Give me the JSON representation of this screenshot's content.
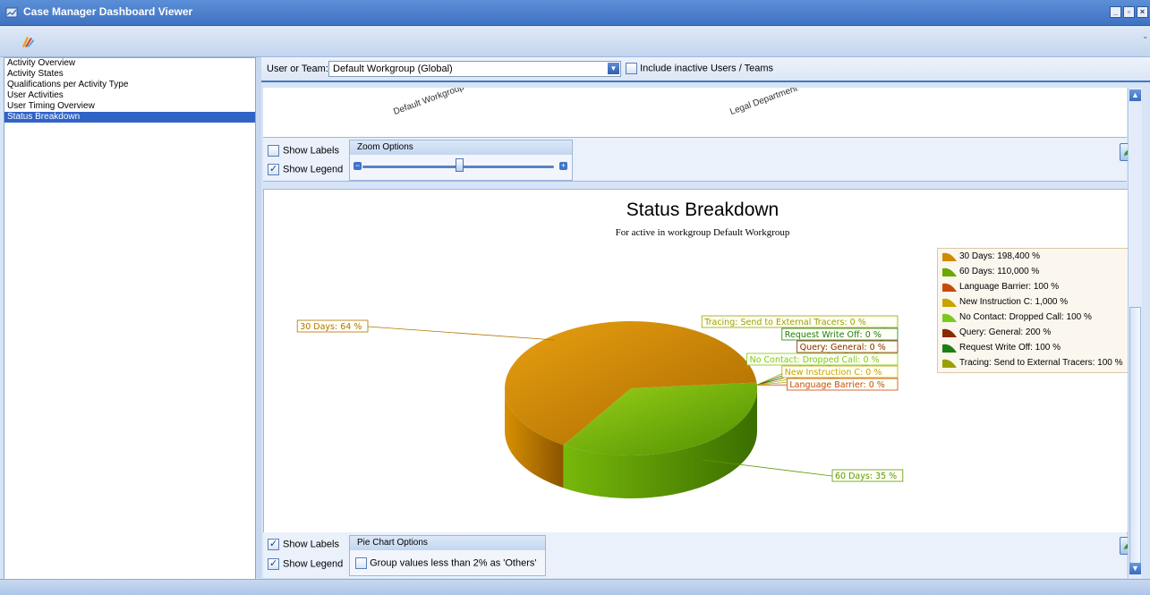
{
  "window": {
    "title": "Case Manager Dashboard Viewer",
    "buttons": [
      "_",
      "▫",
      "×"
    ]
  },
  "nav": {
    "items": [
      {
        "label": "Activity Overview",
        "selected": false
      },
      {
        "label": "Activity States",
        "selected": false
      },
      {
        "label": "Qualifications per Activity Type",
        "selected": false
      },
      {
        "label": "User Activities",
        "selected": false
      },
      {
        "label": "User Timing Overview",
        "selected": false
      },
      {
        "label": "Status Breakdown",
        "selected": true
      }
    ]
  },
  "filter": {
    "label": "User or Team:",
    "value": "Default Workgroup (Global)",
    "include_inactive_label": "Include inactive Users / Teams",
    "include_inactive": false
  },
  "top_chart": {
    "x_labels": [
      "Default Workgroup",
      "Legal Department"
    ]
  },
  "top_options": {
    "show_labels_label": "Show Labels",
    "show_labels": false,
    "show_legend_label": "Show Legend",
    "show_legend": true,
    "zoom_header": "Zoom Options",
    "zoom_minus": "−",
    "zoom_plus": "+"
  },
  "bottom_options": {
    "show_labels_label": "Show Labels",
    "show_labels": true,
    "show_legend_label": "Show Legend",
    "show_legend": true,
    "pie_header": "Pie Chart Options",
    "group_label": "Group values less than 2% as 'Others'",
    "group_checked": false
  },
  "chart_data": {
    "type": "pie",
    "title": "Status Breakdown",
    "subtitle": "For active in workgroup Default Workgroup",
    "slices": [
      {
        "name": "30 Days",
        "percent": 64,
        "label": "30 Days: 64 %",
        "color": "#d08a00"
      },
      {
        "name": "60 Days",
        "percent": 35,
        "label": "60 Days: 35 %",
        "color": "#6aa800"
      },
      {
        "name": "Language Barrier",
        "percent": 0,
        "label": "Language Barrier: 0 %",
        "color": "#c84a0a"
      },
      {
        "name": "New Instruction C",
        "percent": 0,
        "label": "New Instruction C: 0 %",
        "color": "#c8a400"
      },
      {
        "name": "No Contact: Dropped Call",
        "percent": 0,
        "label": "No Contact: Dropped Call: 0 %",
        "color": "#7cc81e"
      },
      {
        "name": "Query: General",
        "percent": 0,
        "label": "Query: General: 0 %",
        "color": "#8a2a00"
      },
      {
        "name": "Request Write Off",
        "percent": 0,
        "label": "Request Write Off: 0 %",
        "color": "#1e7d14"
      },
      {
        "name": "Tracing: Send to External Tracers",
        "percent": 0,
        "label": "Tracing: Send to External Tracers: 0 %",
        "color": "#9aa000"
      }
    ],
    "legend": [
      {
        "text": "30 Days: 198,400 %",
        "color": "#d08a00"
      },
      {
        "text": "60 Days: 110,000 %",
        "color": "#6aa800"
      },
      {
        "text": "Language Barrier: 100 %",
        "color": "#c84a0a"
      },
      {
        "text": "New Instruction C: 1,000 %",
        "color": "#c8a400"
      },
      {
        "text": "No Contact: Dropped Call: 100 %",
        "color": "#7cc81e"
      },
      {
        "text": "Query: General: 200 %",
        "color": "#8a2a00"
      },
      {
        "text": "Request Write Off: 100 %",
        "color": "#1e7d14"
      },
      {
        "text": "Tracing: Send to External Tracers: 100 %",
        "color": "#9aa000"
      }
    ],
    "legend_position": "right"
  }
}
